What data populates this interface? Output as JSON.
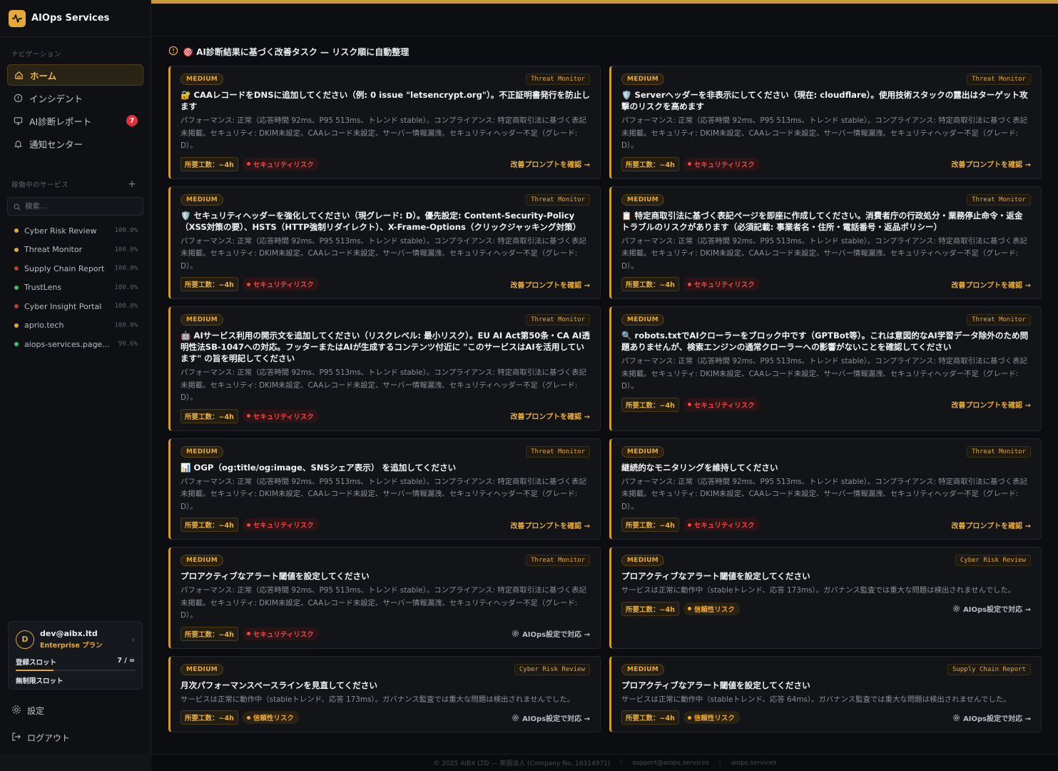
{
  "brand": {
    "title": "AIOps Services"
  },
  "nav": {
    "section_label": "ナビゲーション",
    "items": [
      {
        "label": "ホーム",
        "icon": "home-icon",
        "active": true
      },
      {
        "label": "インシデント",
        "icon": "alert-circle-icon"
      },
      {
        "label": "AI診断レポート",
        "icon": "monitor-icon",
        "badge": "7"
      },
      {
        "label": "通知センター",
        "icon": "bell-icon"
      }
    ]
  },
  "services": {
    "section_label": "稼働中のサービス",
    "add_label": "+",
    "search_placeholder": "検索...",
    "items": [
      {
        "name": "Cyber Risk Review",
        "pct": "100.0%",
        "color": "#e0a73e"
      },
      {
        "name": "Threat Monitor",
        "pct": "100.0%",
        "color": "#e0a73e"
      },
      {
        "name": "Supply Chain Report",
        "pct": "100.0%",
        "color": "#b5412f"
      },
      {
        "name": "TrustLens",
        "pct": "100.0%",
        "color": "#3fbf6a"
      },
      {
        "name": "Cyber Insight Portal",
        "pct": "100.0%",
        "color": "#b5412f"
      },
      {
        "name": "aprio.tech",
        "pct": "100.0%",
        "color": "#e0a73e"
      },
      {
        "name": "aiops-services.page...",
        "pct": "99.6%",
        "color": "#3fbf6a"
      }
    ]
  },
  "account": {
    "avatar": "D",
    "email": "dev@aibx.ltd",
    "plan": "Enterprise プラン",
    "slot_label": "登録スロット",
    "slot_value": "7 / ∞",
    "slot_note": "無制限スロット"
  },
  "links": {
    "settings": "設定",
    "logout": "ログアウト"
  },
  "main": {
    "title": "🎯 AI診断結果に基づく改善タスク — リスク順に自動整理"
  },
  "common": {
    "severity": "MEDIUM",
    "effort": "所要工数：~4h",
    "security_risk": "セキュリティリスク",
    "trust_risk": "信頼性リスク",
    "cta_prompt": "改善プロンプトを確認 →",
    "cta_settings": "AIOps設定で対応 →",
    "body_threat": "パフォーマンス: 正常（応答時間 92ms、P95 513ms、トレンド stable）。コンプライアンス: 特定商取引法に基づく表記 未掲載。セキュリティ: DKIM未設定、CAAレコード未設定、サーバー情報漏洩、セキュリティヘッダー不足（グレード: D）。"
  },
  "cards": [
    {
      "source": "Threat Monitor",
      "title": "🔐 CAAレコードをDNSに追加してください（例: 0 issue \"letsencrypt.org\"）。不正証明書発行を防止します",
      "body": "パフォーマンス: 正常（応答時間 92ms、P95 513ms、トレンド stable）。コンプライアンス: 特定商取引法に基づく表記 未掲載。セキュリティ: DKIM未設定、CAAレコード未設定、サーバー情報漏洩、セキュリティヘッダー不足（グレード: D）。",
      "risk": "セキュリティリスク",
      "risk_type": "red",
      "cta": "改善プロンプトを確認 →",
      "cta_type": "amber"
    },
    {
      "source": "Threat Monitor",
      "title": "🛡️ Serverヘッダーを非表示にしてください（現在: cloudflare）。使用技術スタックの露出はターゲット攻撃のリスクを高めます",
      "body": "パフォーマンス: 正常（応答時間 92ms、P95 513ms、トレンド stable）。コンプライアンス: 特定商取引法に基づく表記 未掲載。セキュリティ: DKIM未設定、CAAレコード未設定、サーバー情報漏洩、セキュリティヘッダー不足（グレード: D）。",
      "risk": "セキュリティリスク",
      "risk_type": "red",
      "cta": "改善プロンプトを確認 →",
      "cta_type": "amber"
    },
    {
      "source": "Threat Monitor",
      "title": "🛡️ セキュリティヘッダーを強化してください（現グレード: D）。優先設定: Content-Security-Policy（XSS対策の要）、HSTS（HTTP強制リダイレクト）、X-Frame-Options（クリックジャッキング対策）",
      "body": "パフォーマンス: 正常（応答時間 92ms、P95 513ms、トレンド stable）。コンプライアンス: 特定商取引法に基づく表記 未掲載。セキュリティ: DKIM未設定、CAAレコード未設定、サーバー情報漏洩、セキュリティヘッダー不足（グレード: D）。",
      "risk": "セキュリティリスク",
      "risk_type": "red",
      "cta": "改善プロンプトを確認 →",
      "cta_type": "amber"
    },
    {
      "source": "Threat Monitor",
      "title": "📋 特定商取引法に基づく表記ページを即座に作成してください。消費者庁の行政処分・業務停止命令・返金トラブルのリスクがあります（必須記載: 事業者名・住所・電話番号・返品ポリシー）",
      "body": "パフォーマンス: 正常（応答時間 92ms、P95 513ms、トレンド stable）。コンプライアンス: 特定商取引法に基づく表記 未掲載。セキュリティ: DKIM未設定、CAAレコード未設定、サーバー情報漏洩、セキュリティヘッダー不足（グレード: D）。",
      "risk": "セキュリティリスク",
      "risk_type": "red",
      "cta": "改善プロンプトを確認 →",
      "cta_type": "amber"
    },
    {
      "source": "Threat Monitor",
      "title": "🤖 AIサービス利用の開示文を追加してください（リスクレベル: 最小リスク）。EU AI Act第50条・CA AI透明性法SB-1047への対応。フッターまたはAIが生成するコンテンツ付近に \"このサービスはAIを活用しています\" の旨を明記してください",
      "body": "パフォーマンス: 正常（応答時間 92ms、P95 513ms、トレンド stable）。コンプライアンス: 特定商取引法に基づく表記 未掲載。セキュリティ: DKIM未設定、CAAレコード未設定、サーバー情報漏洩、セキュリティヘッダー不足（グレード: D）。",
      "risk": "セキュリティリスク",
      "risk_type": "red",
      "cta": "改善プロンプトを確認 →",
      "cta_type": "amber"
    },
    {
      "source": "Threat Monitor",
      "title": "🔍 robots.txtでAIクローラーをブロック中です（GPTBot等）。これは意図的なAI学習データ除外のため問題ありませんが、検索エンジンの通常クローラーへの影響がないことを確認してください",
      "body": "パフォーマンス: 正常（応答時間 92ms、P95 513ms、トレンド stable）。コンプライアンス: 特定商取引法に基づく表記 未掲載。セキュリティ: DKIM未設定、CAAレコード未設定、サーバー情報漏洩、セキュリティヘッダー不足（グレード: D）。",
      "risk": "セキュリティリスク",
      "risk_type": "red",
      "cta": "改善プロンプトを確認 →",
      "cta_type": "amber"
    },
    {
      "source": "Threat Monitor",
      "title": "📊 OGP（og:title/og:image、SNSシェア表示） を追加してください",
      "body": "パフォーマンス: 正常（応答時間 92ms、P95 513ms、トレンド stable）。コンプライアンス: 特定商取引法に基づく表記 未掲載。セキュリティ: DKIM未設定、CAAレコード未設定、サーバー情報漏洩、セキュリティヘッダー不足（グレード: D）。",
      "risk": "セキュリティリスク",
      "risk_type": "red",
      "cta": "改善プロンプトを確認 →",
      "cta_type": "amber"
    },
    {
      "source": "Threat Monitor",
      "title": "継続的なモニタリングを維持してください",
      "body": "パフォーマンス: 正常（応答時間 92ms、P95 513ms、トレンド stable）。コンプライアンス: 特定商取引法に基づく表記 未掲載。セキュリティ: DKIM未設定、CAAレコード未設定、サーバー情報漏洩、セキュリティヘッダー不足（グレード: D）。",
      "risk": "セキュリティリスク",
      "risk_type": "red",
      "cta": "改善プロンプトを確認 →",
      "cta_type": "amber"
    },
    {
      "source": "Threat Monitor",
      "title": "プロアクティブなアラート閾値を設定してください",
      "body": "パフォーマンス: 正常（応答時間 92ms、P95 513ms、トレンド stable）。コンプライアンス: 特定商取引法に基づく表記 未掲載。セキュリティ: DKIM未設定、CAAレコード未設定、サーバー情報漏洩、セキュリティヘッダー不足（グレード: D）。",
      "risk": "セキュリティリスク",
      "risk_type": "red",
      "cta": "AIOps設定で対応 →",
      "cta_type": "gray"
    },
    {
      "source": "Cyber Risk Review",
      "title": "プロアクティブなアラート閾値を設定してください",
      "body": "サービスは正常に動作中（stableトレンド、応答 173ms）。ガバナンス監査では重大な問題は検出されませんでした。",
      "risk": "信頼性リスク",
      "risk_type": "amber",
      "cta": "AIOps設定で対応 →",
      "cta_type": "gray"
    },
    {
      "source": "Cyber Risk Review",
      "title": "月次パフォーマンスベースラインを見直してください",
      "body": "サービスは正常に動作中（stableトレンド、応答 173ms）。ガバナンス監査では重大な問題は検出されませんでした。",
      "risk": "信頼性リスク",
      "risk_type": "amber",
      "cta": "AIOps設定で対応 →",
      "cta_type": "gray"
    },
    {
      "source": "Supply Chain Report",
      "title": "プロアクティブなアラート閾値を設定してください",
      "body": "サービスは正常に動作中（stableトレンド、応答 64ms）。ガバナンス監査では重大な問題は検出されませんでした。",
      "risk": "信頼性リスク",
      "risk_type": "amber",
      "cta": "AIOps設定で対応 →",
      "cta_type": "gray"
    }
  ],
  "footer": {
    "copyright": "© 2025 AIBX LTD — 英国法人 (Company No. 16314971)",
    "support": "support@aiops.services",
    "site": "aiops.services"
  }
}
